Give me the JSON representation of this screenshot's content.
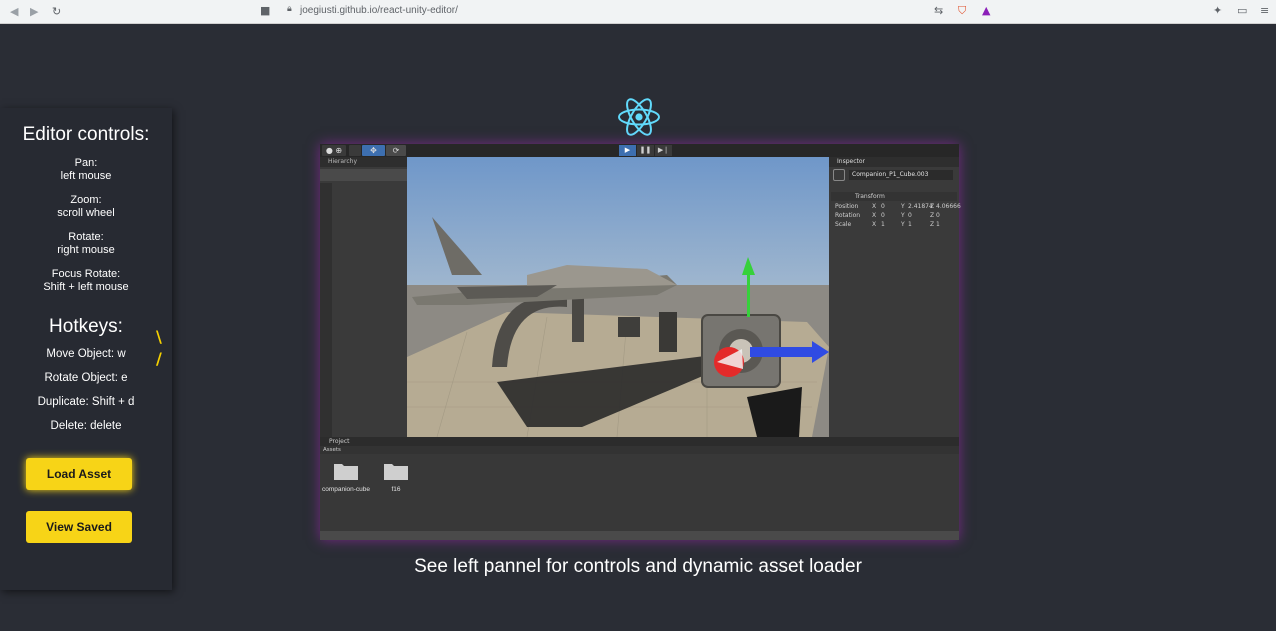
{
  "browser": {
    "url": "joegiusti.github.io/react-unity-editor/",
    "back_icon": "arrow-left-icon",
    "forward_icon": "arrow-right-icon",
    "reload_icon": "reload-icon"
  },
  "panel": {
    "title": "Editor controls:",
    "controls": [
      {
        "action": "Pan:",
        "binding": "left mouse"
      },
      {
        "action": "Zoom:",
        "binding": "scroll wheel"
      },
      {
        "action": "Rotate:",
        "binding": "right mouse"
      },
      {
        "action": "Focus Rotate:",
        "binding": "Shift + left mouse"
      }
    ],
    "hotkeys_title": "Hotkeys:",
    "hotkeys": [
      "Move Object: w",
      "Rotate Object: e",
      "Duplicate: Shift + d",
      "Delete: delete"
    ],
    "load_button": "Load Asset",
    "view_button": "View Saved",
    "accent_color": "#f7d417"
  },
  "editor": {
    "hierarchy_tab": "Hierarchy",
    "inspector_tab": "Inspector",
    "object_name": "Companion_P1_Cube.003",
    "component": "Transform",
    "transform": [
      {
        "label": "Position",
        "x": "0",
        "y": "2.41874",
        "z": "4.06666"
      },
      {
        "label": "Rotation",
        "x": "0",
        "y": "0",
        "z": "0"
      },
      {
        "label": "Scale",
        "x": "1",
        "y": "1",
        "z": "1"
      }
    ],
    "project_tab": "Project",
    "assets_label": "Assets",
    "assets": [
      "companion-cube",
      "f16"
    ]
  },
  "caption": "See left pannel for controls and dynamic asset loader"
}
